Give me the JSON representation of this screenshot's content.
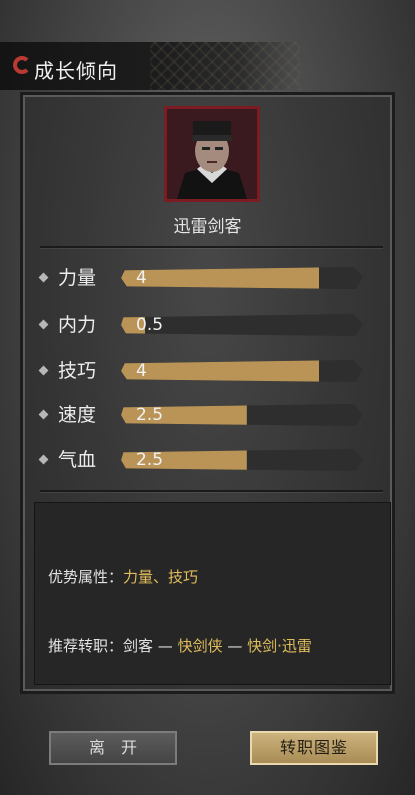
{
  "header": {
    "title": "成长倾向"
  },
  "character": {
    "name": "迅雷剑客"
  },
  "stats": [
    {
      "label": "力量",
      "value": "4",
      "fill": 0.82
    },
    {
      "label": "内力",
      "value": "0.5",
      "fill": 0.1
    },
    {
      "label": "技巧",
      "value": "4",
      "fill": 0.82
    },
    {
      "label": "速度",
      "value": "2.5",
      "fill": 0.52
    },
    {
      "label": "气血",
      "value": "2.5",
      "fill": 0.52
    }
  ],
  "info": {
    "advantage_label": "优势属性：",
    "advantage_value": "力量、技巧",
    "recommend_label": "推荐转职：",
    "recommend_start": "剑客",
    "sep1": " — ",
    "recommend_mid": "快剑侠",
    "sep2": " — ",
    "recommend_end": "快剑·迅雷"
  },
  "buttons": {
    "leave": "离开",
    "atlas": "转职图鉴"
  },
  "colors": {
    "bar_fill": "#b99456",
    "highlight": "#e2bd5c",
    "portrait_border": "#7a1c22"
  }
}
